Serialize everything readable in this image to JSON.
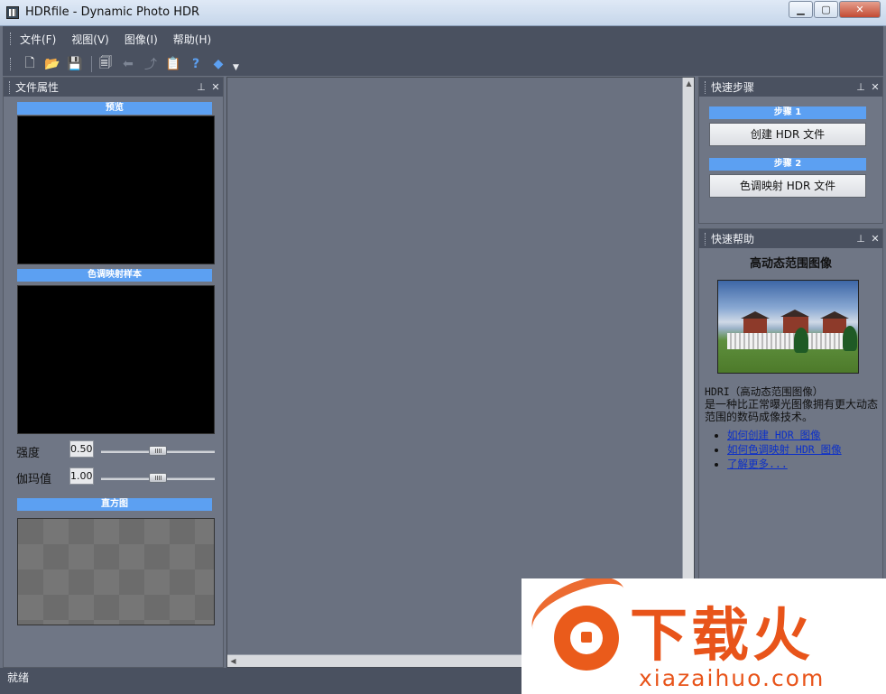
{
  "window": {
    "title": "HDRfile - Dynamic Photo HDR",
    "controls": {
      "minimize": "▁",
      "maximize": "▢",
      "close": "✕"
    }
  },
  "menu": [
    "文件(F)",
    "视图(V)",
    "图像(I)",
    "帮助(H)"
  ],
  "toolbar": {
    "buttons": [
      {
        "icon": "new-file-icon",
        "glyph": "🗋",
        "enabled": true
      },
      {
        "icon": "open-folder-icon",
        "glyph": "📂",
        "enabled": true
      },
      {
        "icon": "save-icon",
        "glyph": "💾",
        "enabled": true
      },
      {
        "icon": "save-all-icon",
        "glyph": "🗐",
        "enabled": true
      },
      {
        "icon": "back-arrow-icon",
        "glyph": "⬅",
        "enabled": false
      },
      {
        "icon": "export-icon",
        "glyph": "⤴",
        "enabled": false
      },
      {
        "icon": "paste-icon",
        "glyph": "📋",
        "enabled": false
      },
      {
        "icon": "help-icon",
        "glyph": "?",
        "enabled": true
      },
      {
        "icon": "about-icon",
        "glyph": "◆",
        "enabled": true
      }
    ]
  },
  "left_panel": {
    "title": "文件属性",
    "preview_label": "预览",
    "tonemap_label": "色调映射样本",
    "strength": {
      "label": "强度",
      "value": "0.50",
      "level": 0.5
    },
    "gamma": {
      "label": "伽玛值",
      "value": "1.00",
      "level": 0.5
    },
    "histogram_label": "直方图"
  },
  "quick_steps": {
    "title": "快速步骤",
    "step1_label": "步骤 1",
    "step1_button": "创建 HDR 文件",
    "step2_label": "步骤 2",
    "step2_button": "色调映射 HDR 文件"
  },
  "quick_help": {
    "title": "快速帮助",
    "heading": "高动态范围图像",
    "description_line1": "HDRI（高动态范围图像）",
    "description_line2": "是一种比正常曝光图像拥有更大动态范围的数码成像技术。",
    "links": [
      "如何创建 HDR 图像",
      "如何色调映射 HDR 图像",
      "了解更多..."
    ]
  },
  "status": {
    "text": "就绪"
  },
  "watermark": {
    "title": "下载火",
    "url": "xiazaihuo.com"
  },
  "colors": {
    "panel_bg": "#6f7685",
    "header_bg": "#4a5160",
    "section_label": "#5ca0f2",
    "workspace_bg": "#6a7180",
    "link": "#0b2fc9",
    "watermark": "#e8541a"
  }
}
